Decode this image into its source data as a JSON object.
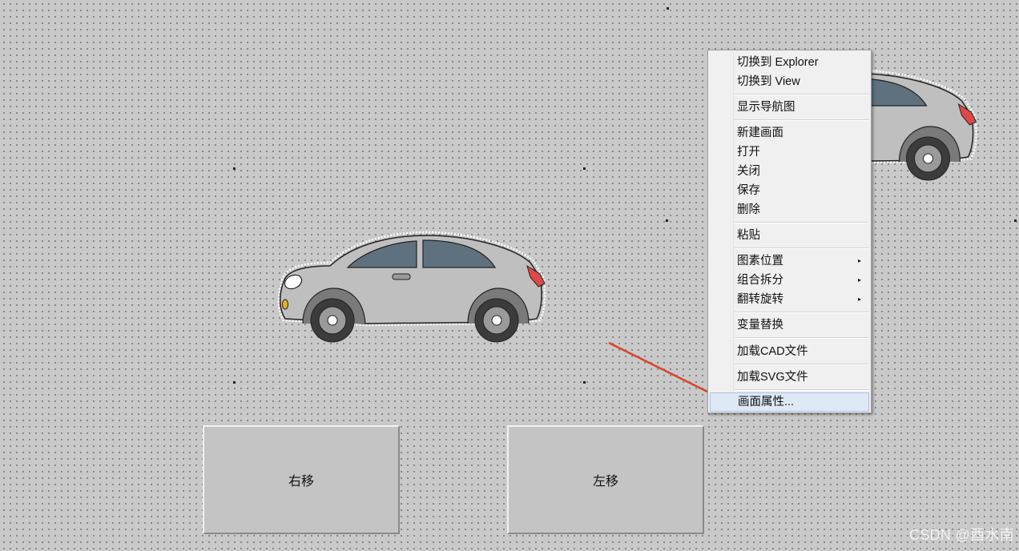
{
  "canvas": {
    "background_color": "#c9c9c9"
  },
  "buttons": {
    "move_right_label": "右移",
    "move_left_label": "左移"
  },
  "context_menu": {
    "items": [
      {
        "label": "切换到 Explorer",
        "has_submenu": false
      },
      {
        "label": "切换到 View",
        "has_submenu": false
      },
      {
        "label": "显示导航图",
        "has_submenu": false
      },
      {
        "label": "新建画面",
        "has_submenu": false
      },
      {
        "label": "打开",
        "has_submenu": false
      },
      {
        "label": "关闭",
        "has_submenu": false
      },
      {
        "label": "保存",
        "has_submenu": false
      },
      {
        "label": "删除",
        "has_submenu": false
      },
      {
        "label": "粘贴",
        "has_submenu": false
      },
      {
        "label": "图素位置",
        "has_submenu": true
      },
      {
        "label": "组合拆分",
        "has_submenu": true
      },
      {
        "label": "翻转旋转",
        "has_submenu": true
      },
      {
        "label": "变量替换",
        "has_submenu": false
      },
      {
        "label": "加载CAD文件",
        "has_submenu": false
      },
      {
        "label": "加载SVG文件",
        "has_submenu": false
      },
      {
        "label": "画面属性...",
        "has_submenu": false,
        "highlighted": true
      }
    ],
    "submenu_arrow": "▸"
  },
  "annotation": {
    "arrow_color": "#d8422a"
  },
  "car": {
    "body_color": "#bfbfbf",
    "window_color": "#5f717e",
    "tail_light_color": "#e04848",
    "head_light_color": "#e8b020"
  },
  "watermark": {
    "text": "CSDN @酉水南"
  }
}
